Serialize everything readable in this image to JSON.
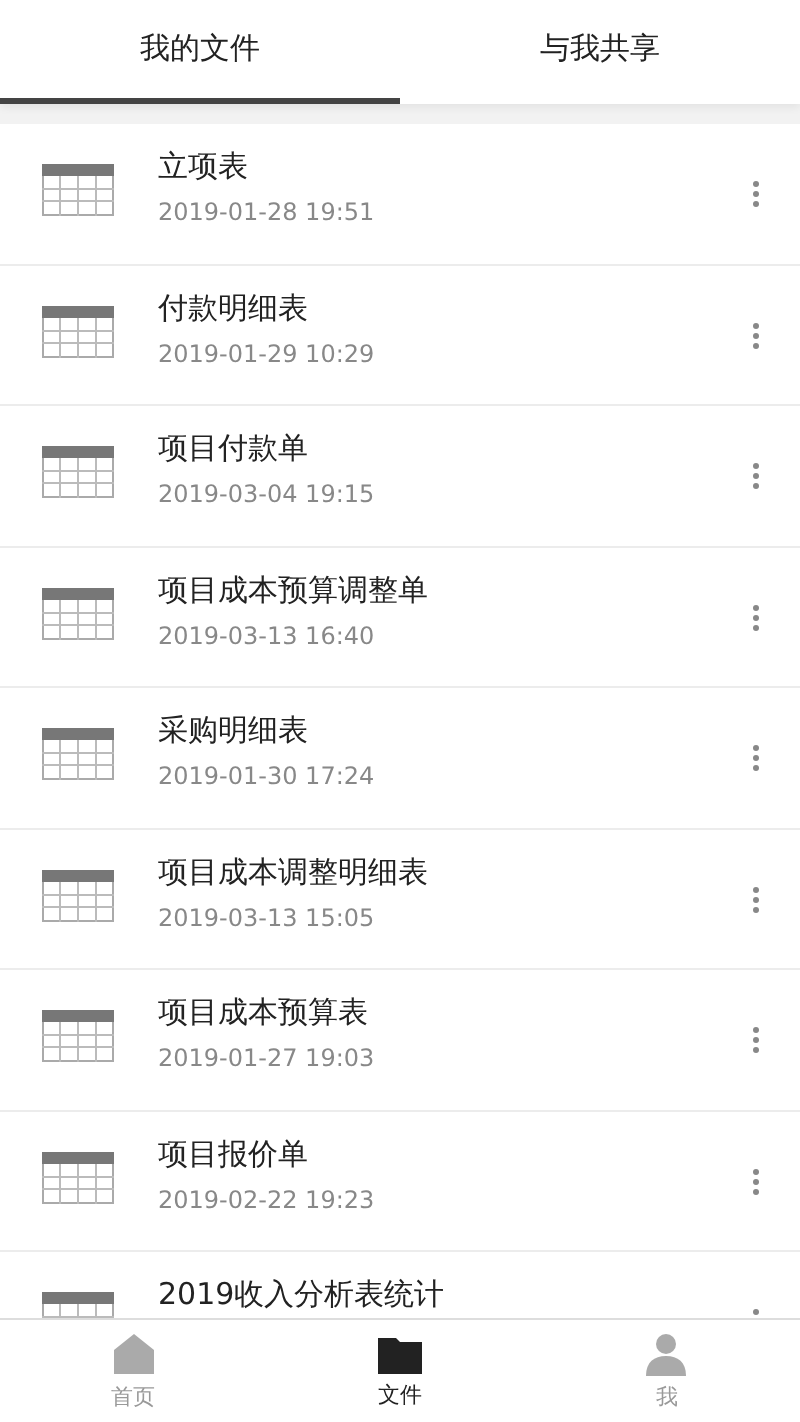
{
  "tabs": [
    {
      "label": "我的文件",
      "selected": true
    },
    {
      "label": "与我共享",
      "selected": false
    }
  ],
  "files": [
    {
      "name": "立项表",
      "time": "2019-01-28 19:51"
    },
    {
      "name": "付款明细表",
      "time": "2019-01-29 10:29"
    },
    {
      "name": "项目付款单",
      "time": "2019-03-04 19:15"
    },
    {
      "name": "项目成本预算调整单",
      "time": "2019-03-13 16:40"
    },
    {
      "name": "采购明细表",
      "time": "2019-01-30 17:24"
    },
    {
      "name": "项目成本调整明细表",
      "time": "2019-03-13 15:05"
    },
    {
      "name": "项目成本预算表",
      "time": "2019-01-27 19:03"
    },
    {
      "name": "项目报价单",
      "time": "2019-02-22 19:23"
    },
    {
      "name": "2019收入分析表统计"
    }
  ],
  "nav": [
    {
      "label": "首页",
      "kind": "home",
      "selected": false
    },
    {
      "label": "文件",
      "kind": "folder",
      "selected": true
    },
    {
      "label": "我",
      "kind": "person",
      "selected": false
    }
  ]
}
